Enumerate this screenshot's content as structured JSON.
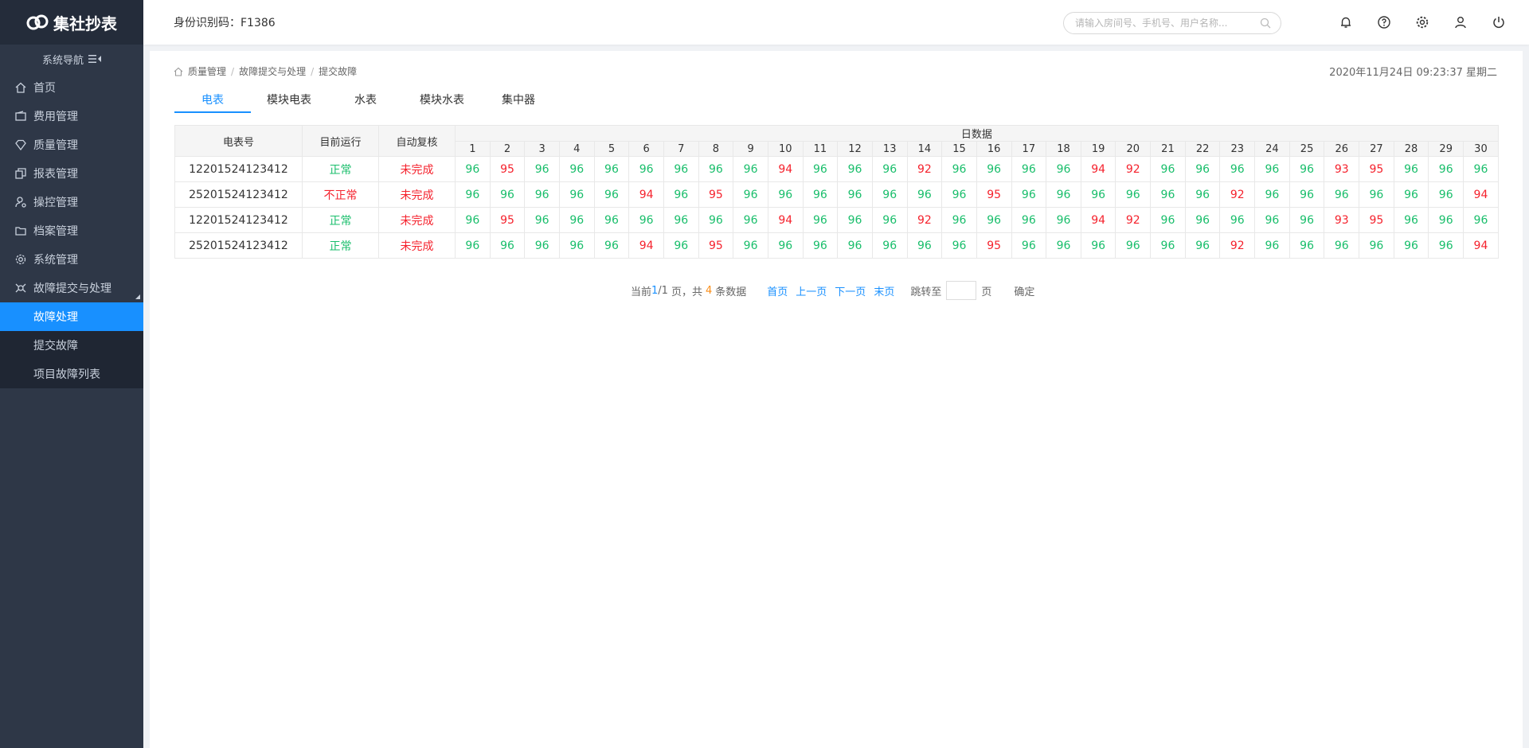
{
  "app": {
    "logo_text": "集社抄表"
  },
  "sidebar": {
    "nav_label": "系统导航",
    "items": [
      {
        "label": "首页",
        "icon": "home-icon"
      },
      {
        "label": "费用管理",
        "icon": "wallet-icon"
      },
      {
        "label": "质量管理",
        "icon": "diamond-icon"
      },
      {
        "label": "报表管理",
        "icon": "copy-icon"
      },
      {
        "label": "操控管理",
        "icon": "user-gear-icon"
      },
      {
        "label": "档案管理",
        "icon": "folder-icon"
      },
      {
        "label": "系统管理",
        "icon": "gear-icon"
      },
      {
        "label": "故障提交与处理",
        "icon": "bug-icon"
      }
    ],
    "submenu": [
      {
        "label": "故障处理",
        "active": true
      },
      {
        "label": "提交故障",
        "active": false
      },
      {
        "label": "项目故障列表",
        "active": false
      }
    ]
  },
  "header": {
    "id_code": "身份识别码：F1386",
    "search_placeholder": "请输入房间号、手机号、用户名称...",
    "icons": [
      "bell-icon",
      "help-icon",
      "settings-icon",
      "user-icon",
      "power-icon"
    ]
  },
  "breadcrumb": [
    "质量管理",
    "故障提交与处理",
    "提交故障"
  ],
  "datetime": "2020年11月24日 09:23:37 星期二",
  "tabs": [
    "电表",
    "模块电表",
    "水表",
    "模块水表",
    "集中器"
  ],
  "table": {
    "headers": {
      "meter": "电表号",
      "running": "目前运行",
      "recheck": "自动复核",
      "daily": "日数据"
    },
    "days": [
      "1",
      "2",
      "3",
      "4",
      "5",
      "6",
      "7",
      "8",
      "9",
      "10",
      "11",
      "12",
      "13",
      "14",
      "15",
      "16",
      "17",
      "18",
      "19",
      "20",
      "21",
      "22",
      "23",
      "24",
      "25",
      "26",
      "27",
      "28",
      "29",
      "30"
    ],
    "rows": [
      {
        "meter": "12201524123412",
        "running": "正常",
        "running_ok": true,
        "recheck": "未完成",
        "values": [
          "96",
          "95",
          "96",
          "96",
          "96",
          "96",
          "96",
          "96",
          "96",
          "94",
          "96",
          "96",
          "96",
          "92",
          "96",
          "96",
          "96",
          "96",
          "94",
          "92",
          "96",
          "96",
          "96",
          "96",
          "96",
          "93",
          "95",
          "96",
          "96",
          "96"
        ]
      },
      {
        "meter": "25201524123412",
        "running": "不正常",
        "running_ok": false,
        "recheck": "未完成",
        "values": [
          "96",
          "96",
          "96",
          "96",
          "96",
          "94",
          "96",
          "95",
          "96",
          "96",
          "96",
          "96",
          "96",
          "96",
          "96",
          "95",
          "96",
          "96",
          "96",
          "96",
          "96",
          "96",
          "92",
          "96",
          "96",
          "96",
          "96",
          "96",
          "96",
          "94"
        ]
      },
      {
        "meter": "12201524123412",
        "running": "正常",
        "running_ok": true,
        "recheck": "未完成",
        "values": [
          "96",
          "95",
          "96",
          "96",
          "96",
          "96",
          "96",
          "96",
          "96",
          "94",
          "96",
          "96",
          "96",
          "92",
          "96",
          "96",
          "96",
          "96",
          "94",
          "92",
          "96",
          "96",
          "96",
          "96",
          "96",
          "93",
          "95",
          "96",
          "96",
          "96"
        ]
      },
      {
        "meter": "25201524123412",
        "running": "正常",
        "running_ok": true,
        "recheck": "未完成",
        "values": [
          "96",
          "96",
          "96",
          "96",
          "96",
          "94",
          "96",
          "95",
          "96",
          "96",
          "96",
          "96",
          "96",
          "96",
          "96",
          "95",
          "96",
          "96",
          "96",
          "96",
          "96",
          "96",
          "92",
          "96",
          "96",
          "96",
          "96",
          "96",
          "96",
          "94"
        ]
      }
    ]
  },
  "pager": {
    "prefix": "当前",
    "current": "1",
    "total": "/1",
    "mid": "页，共",
    "count": "4",
    "suffix": "条数据",
    "first": "首页",
    "prev": "上一页",
    "next": "下一页",
    "last": "末页",
    "jump_label": "跳转至",
    "page_unit": "页",
    "confirm": "确定"
  },
  "colors": {
    "accent": "#1890ff",
    "ok": "#19be6b",
    "bad": "#f5222d"
  }
}
